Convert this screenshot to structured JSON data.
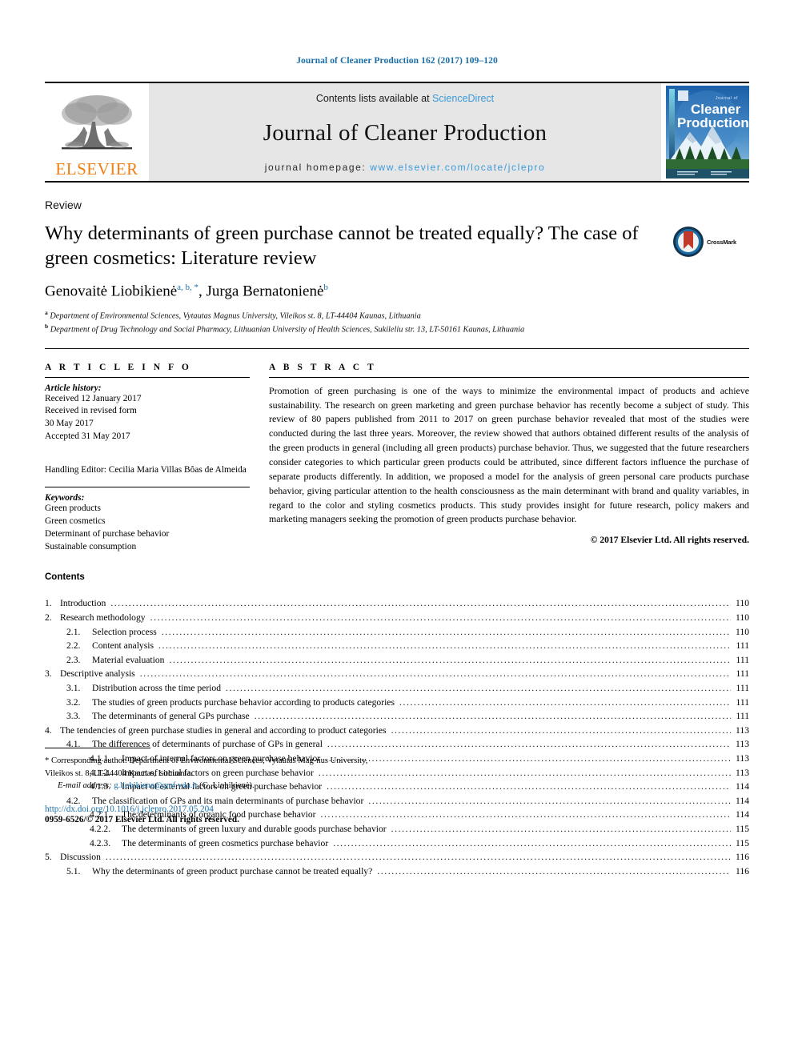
{
  "running_head": "Journal of Cleaner Production 162 (2017) 109–120",
  "masthead": {
    "publisher_name": "ELSEVIER",
    "contents_prefix": "Contents lists available at ",
    "contents_link": "ScienceDirect",
    "journal_name": "Journal of Cleaner Production",
    "homepage_prefix": "journal homepage: ",
    "homepage_url": "www.elsevier.com/locate/jclepro",
    "cover_title_small": "Journal of",
    "cover_title_line1": "Cleaner",
    "cover_title_line2": "Production"
  },
  "article": {
    "type": "Review",
    "title": "Why determinants of green purchase cannot be treated equally? The case of green cosmetics: Literature review",
    "crossmark_label": "CrossMark",
    "author1": "Genovaitė Liobikienė",
    "author1_sups": "a, b, *",
    "author2": "Jurga Bernatonienė",
    "author2_sups": "b",
    "affiliation_a": "Department of Environmental Sciences, Vytautas Magnus University, Vileikos st. 8, LT-44404 Kaunas, Lithuania",
    "affiliation_b": "Department of Drug Technology and Social Pharmacy, Lithuanian University of Health Sciences, Sukileliu str. 13, LT-50161 Kaunas, Lithuania"
  },
  "article_info": {
    "heading": "A R T I C L E  I N F O",
    "history_label": "Article history:",
    "received": "Received 12 January 2017",
    "revised_label": "Received in revised form",
    "revised_date": "30 May 2017",
    "accepted": "Accepted 31 May 2017",
    "handling_editor": "Handling Editor: Cecilia Maria Villas Bôas de Almeida",
    "keywords_label": "Keywords:",
    "keywords": [
      "Green products",
      "Green cosmetics",
      "Determinant of purchase behavior",
      "Sustainable consumption"
    ]
  },
  "abstract": {
    "heading": "A B S T R A C T",
    "text": "Promotion of green purchasing is one of the ways to minimize the environmental impact of products and achieve sustainability. The research on green marketing and green purchase behavior has recently become a subject of study. This review of 80 papers published from 2011 to 2017 on green purchase behavior revealed that most of the studies were conducted during the last three years. Moreover, the review showed that authors obtained different results of the analysis of the green products in general (including all green products) purchase behavior. Thus, we suggested that the future researchers consider categories to which particular green products could be attributed, since different factors influence the purchase of separate products differently. In addition, we proposed a model for the analysis of green personal care products purchase behavior, giving particular attention to the health consciousness as the main determinant with brand and quality variables, in regard to the color and styling cosmetics products. This study provides insight for future research, policy makers and marketing managers seeking the promotion of green products purchase behavior.",
    "copyright": "© 2017 Elsevier Ltd. All rights reserved."
  },
  "contents": {
    "title": "Contents",
    "entries": [
      {
        "level": 1,
        "num": "1.",
        "label": "Introduction",
        "page": "110"
      },
      {
        "level": 1,
        "num": "2.",
        "label": "Research methodology",
        "page": "110"
      },
      {
        "level": 2,
        "num": "2.1.",
        "label": "Selection process",
        "page": "110"
      },
      {
        "level": 2,
        "num": "2.2.",
        "label": "Content analysis",
        "page": "111"
      },
      {
        "level": 2,
        "num": "2.3.",
        "label": "Material evaluation",
        "page": "111"
      },
      {
        "level": 1,
        "num": "3.",
        "label": "Descriptive analysis",
        "page": "111"
      },
      {
        "level": 2,
        "num": "3.1.",
        "label": "Distribution across the time period",
        "page": "111"
      },
      {
        "level": 2,
        "num": "3.2.",
        "label": "The studies of green products purchase behavior according to products categories",
        "page": "111"
      },
      {
        "level": 2,
        "num": "3.3.",
        "label": "The determinants of general GPs purchase",
        "page": "111"
      },
      {
        "level": 1,
        "num": "4.",
        "label": "The tendencies of green purchase studies in general and according to product categories",
        "page": "113"
      },
      {
        "level": 2,
        "num": "4.1.",
        "label": "The differences of determinants of purchase of GPs in general",
        "page": "113"
      },
      {
        "level": 3,
        "num": "4.1.1.",
        "label": "Impact of internal factors on green purchase behavior",
        "page": "113"
      },
      {
        "level": 3,
        "num": "4.1.2.",
        "label": "Impact of social factors on green purchase behavior",
        "page": "113"
      },
      {
        "level": 3,
        "num": "4.1.3.",
        "label": "Impact of external factors on green purchase behavior",
        "page": "114"
      },
      {
        "level": 2,
        "num": "4.2.",
        "label": "The classification of GPs and its main determinants of purchase behavior",
        "page": "114"
      },
      {
        "level": 3,
        "num": "4.2.1.",
        "label": "The determinants of organic food purchase behavior",
        "page": "114"
      },
      {
        "level": 3,
        "num": "4.2.2.",
        "label": "The determinants of green luxury and durable goods purchase behavior",
        "page": "115"
      },
      {
        "level": 3,
        "num": "4.2.3.",
        "label": "The determinants of green cosmetics purchase behavior",
        "page": "115"
      },
      {
        "level": 1,
        "num": "5.",
        "label": "Discussion",
        "page": "116"
      },
      {
        "level": 2,
        "num": "5.1.",
        "label": "Why the determinants of green product purchase cannot be treated equally?",
        "page": "116"
      }
    ]
  },
  "footer": {
    "corresponding_note": "* Corresponding author. Department of Environmental Sciences, Vytautas Mag-nus University, Vileikos st. 8, LT-44404 Kaunas, Lithuania.",
    "email_label": "E-mail address:",
    "email": "g.liobikiene@gmf.vdu.lt",
    "email_owner": "(G. Liobikienė).",
    "doi": "http://dx.doi.org/10.1016/j.jclepro.2017.05.204",
    "issn": "0959-6526/© 2017 Elsevier Ltd. All rights reserved."
  },
  "colors": {
    "link_blue": "#1a6ea8",
    "sd_blue": "#3b9ad9",
    "elsevier_orange": "#f07f13",
    "band_gray": "#e6e6e6"
  }
}
